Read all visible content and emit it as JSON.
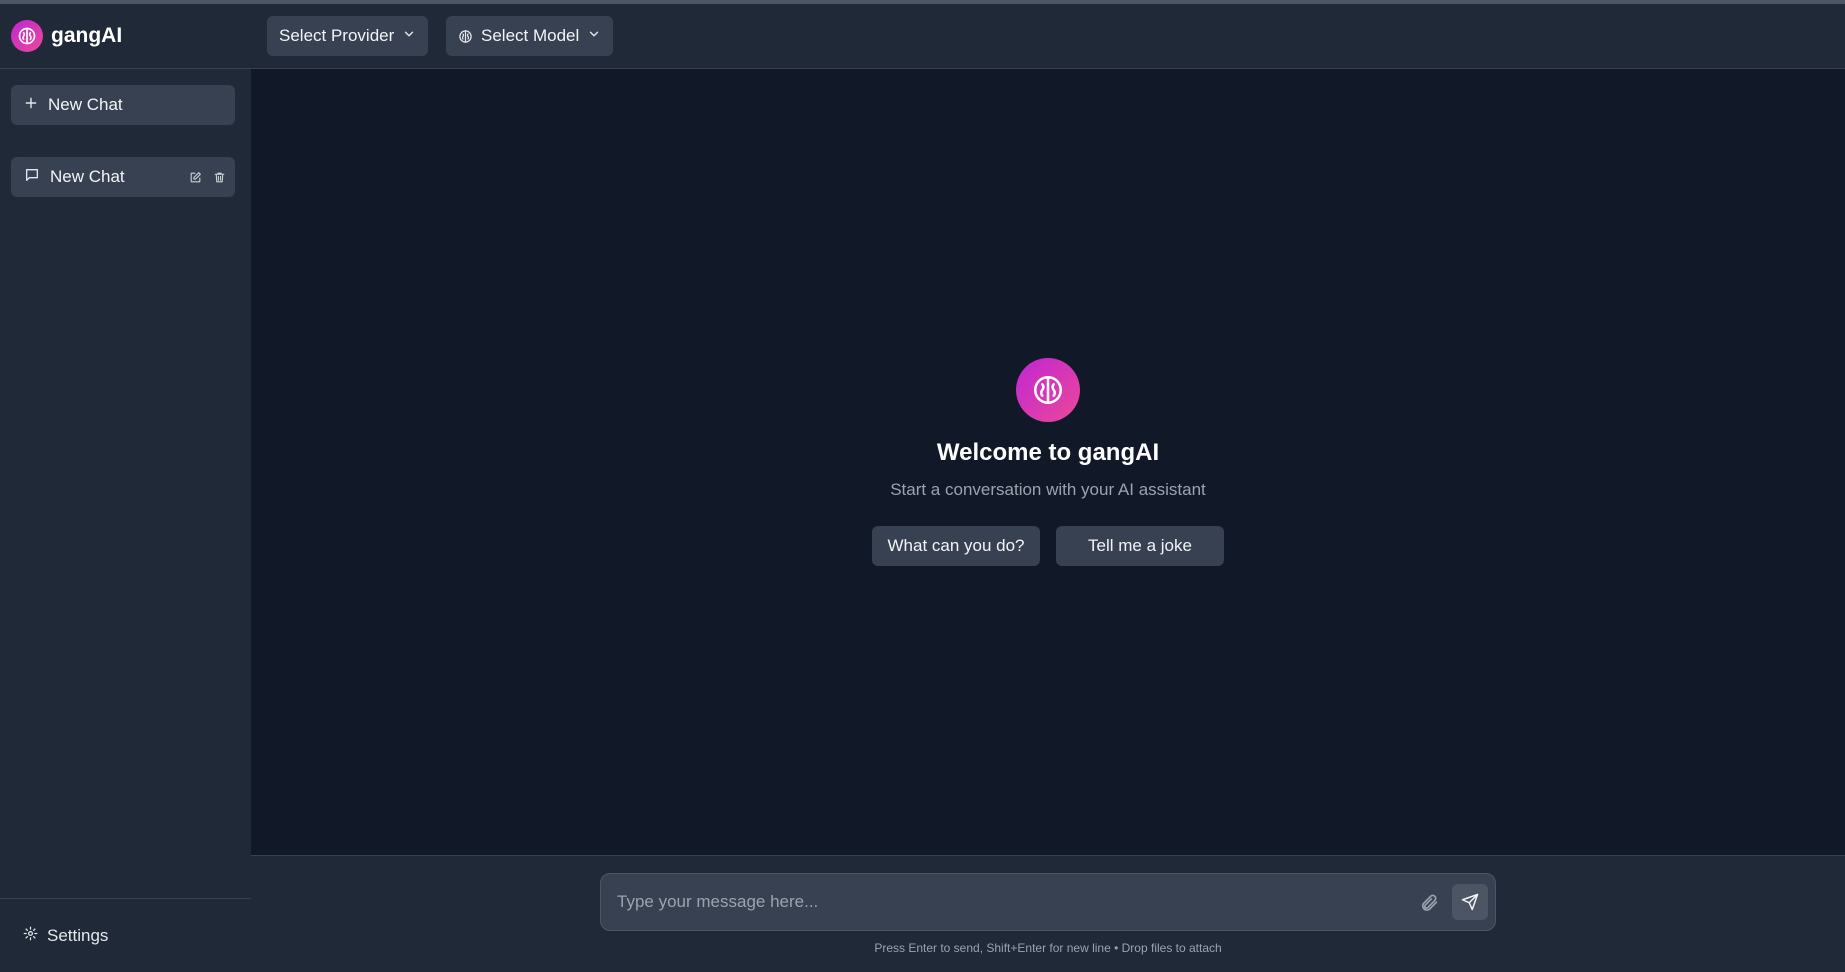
{
  "app": {
    "name": "gangAI"
  },
  "colors": {
    "accent_start": "#c026d3",
    "accent_end": "#ec4899",
    "background": "#111827",
    "panel": "#1f2937"
  },
  "sidebar": {
    "new_chat_label": "New Chat",
    "chats": [
      {
        "label": "New Chat",
        "icon": "message-square-icon"
      }
    ],
    "settings_label": "Settings"
  },
  "header": {
    "provider_label": "Select Provider",
    "model_label": "Select Model"
  },
  "welcome": {
    "title": "Welcome to gangAI",
    "subtitle": "Start a conversation with your AI assistant",
    "suggestions": [
      "What can you do?",
      "Tell me a joke"
    ]
  },
  "composer": {
    "placeholder": "Type your message here...",
    "value": "",
    "hint": "Press Enter to send, Shift+Enter for new line • Drop files to attach"
  }
}
